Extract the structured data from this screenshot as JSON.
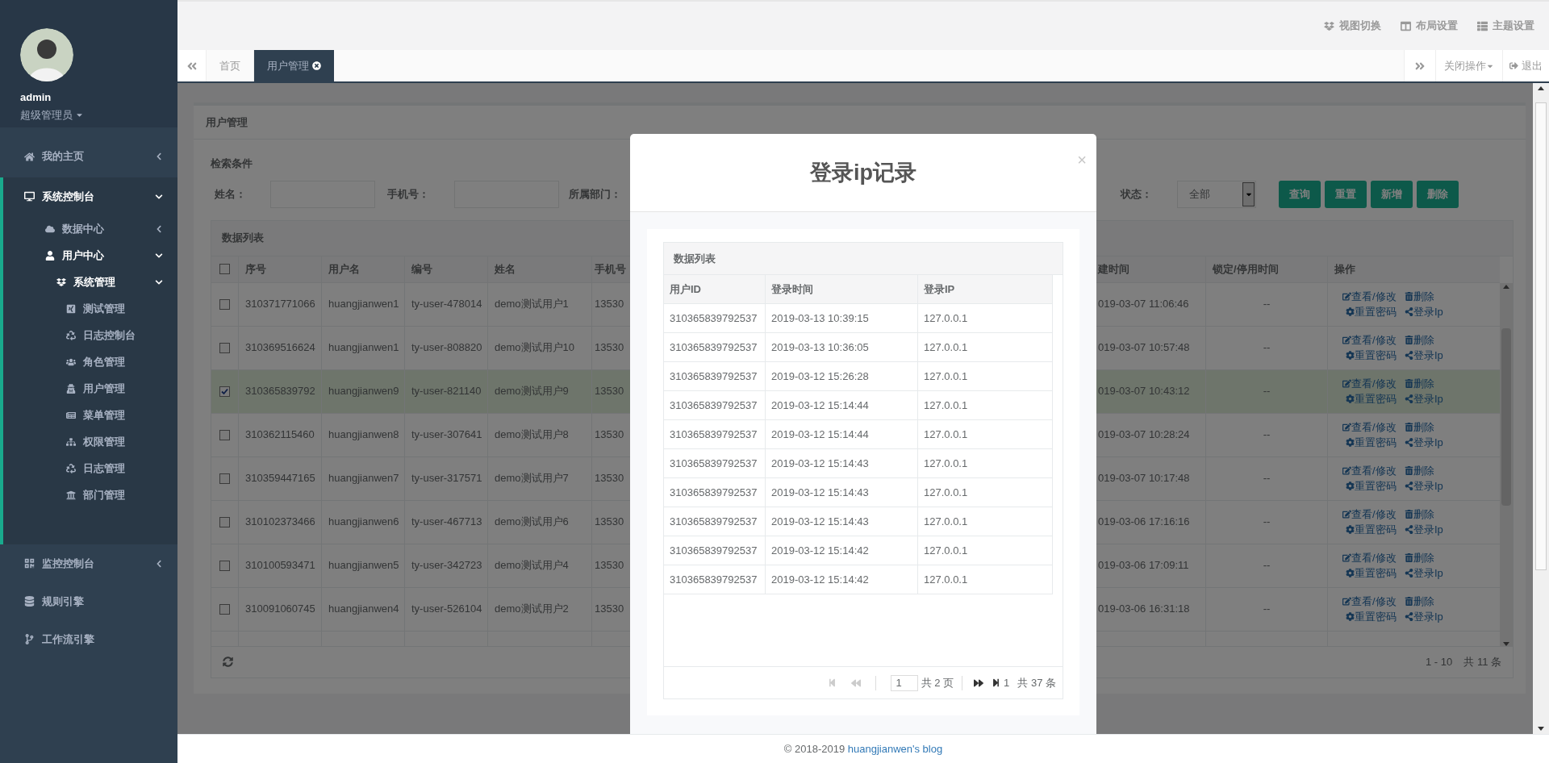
{
  "sidebar": {
    "profile": {
      "name": "admin",
      "role": "超级管理员"
    },
    "menu": [
      {
        "label": "我的主页",
        "kind": "group",
        "expanded": false,
        "selected": false
      },
      {
        "label": "系统控制台",
        "kind": "group",
        "expanded": true,
        "selected": true,
        "children": [
          {
            "label": "数据中心",
            "expanded": false,
            "selected": false
          },
          {
            "label": "用户中心",
            "expanded": true,
            "selected": true,
            "children": [
              {
                "label": "系统管理",
                "expanded": true,
                "selected": true,
                "children": [
                  {
                    "label": "测试管理",
                    "selected": false
                  },
                  {
                    "label": "日志控制台",
                    "selected": false
                  },
                  {
                    "label": "角色管理",
                    "selected": false
                  },
                  {
                    "label": "用户管理",
                    "selected": false
                  },
                  {
                    "label": "菜单管理",
                    "selected": false
                  },
                  {
                    "label": "权限管理",
                    "selected": false
                  },
                  {
                    "label": "日志管理",
                    "selected": false
                  },
                  {
                    "label": "部门管理",
                    "selected": false
                  }
                ]
              }
            ]
          }
        ]
      },
      {
        "label": "监控控制台",
        "kind": "group",
        "expanded": false,
        "selected": false
      },
      {
        "label": "规则引擎",
        "kind": "link",
        "selected": false
      },
      {
        "label": "工作流引擎",
        "kind": "link",
        "selected": false
      }
    ]
  },
  "topbar": {
    "actions": [
      "视图切换",
      "布局设置",
      "主题设置"
    ]
  },
  "tabbar": {
    "tabs": [
      {
        "label": "首页",
        "selected": false
      },
      {
        "label": "用户管理",
        "selected": true
      }
    ],
    "close_menu": "关闭操作",
    "logout": "退出"
  },
  "page": {
    "title": "用户管理",
    "search": {
      "heading": "检索条件",
      "fields": [
        {
          "label": "姓名："
        },
        {
          "label": "手机号："
        }
      ],
      "department_label": "所属部门：",
      "status": {
        "label": "状态：",
        "value": "全部"
      },
      "buttons": [
        "查询",
        "重置",
        "新增",
        "删除"
      ]
    },
    "list": {
      "title": "数据列表",
      "header_checked": false,
      "columns": [
        "序号",
        "用户名",
        "编号",
        "姓名",
        "手机号",
        "建时间",
        "锁定/停用时间",
        "操作"
      ],
      "rows": [
        {
          "selected": false,
          "cells": [
            "310371771066",
            "huangjianwen1",
            "ty-user-478014",
            "demo测试用户1",
            "13530",
            "019-03-07 11:06:46",
            "--"
          ],
          "actions": [
            "查看/修改",
            "删除",
            "重置密码",
            "登录Ip"
          ]
        },
        {
          "selected": false,
          "cells": [
            "310369516624",
            "huangjianwen1",
            "ty-user-808820",
            "demo测试用户10",
            "13530",
            "019-03-07 10:57:48",
            "--"
          ],
          "actions": [
            "查看/修改",
            "删除",
            "重置密码",
            "登录Ip"
          ]
        },
        {
          "selected": true,
          "cells": [
            "310365839792",
            "huangjianwen9",
            "ty-user-821140",
            "demo测试用户9",
            "13530",
            "019-03-07 10:43:12",
            "--"
          ],
          "actions": [
            "查看/修改",
            "删除",
            "重置密码",
            "登录Ip"
          ]
        },
        {
          "selected": false,
          "cells": [
            "310362115460",
            "huangjianwen8",
            "ty-user-307641",
            "demo测试用户8",
            "13530",
            "019-03-07 10:28:24",
            "--"
          ],
          "actions": [
            "查看/修改",
            "删除",
            "重置密码",
            "登录Ip"
          ]
        },
        {
          "selected": false,
          "cells": [
            "310359447165",
            "huangjianwen7",
            "ty-user-317571",
            "demo测试用户7",
            "13530",
            "019-03-07 10:17:48",
            "--"
          ],
          "actions": [
            "查看/修改",
            "删除",
            "重置密码",
            "登录Ip"
          ]
        },
        {
          "selected": false,
          "cells": [
            "310102373466",
            "huangjianwen6",
            "ty-user-467713",
            "demo测试用户6",
            "13530",
            "019-03-06 17:16:16",
            "--"
          ],
          "actions": [
            "查看/修改",
            "删除",
            "重置密码",
            "登录Ip"
          ]
        },
        {
          "selected": false,
          "cells": [
            "310100593471",
            "huangjianwen5",
            "ty-user-342723",
            "demo测试用户4",
            "13530",
            "019-03-06 17:09:11",
            "--"
          ],
          "actions": [
            "查看/修改",
            "删除",
            "重置密码",
            "登录Ip"
          ]
        },
        {
          "selected": false,
          "cells": [
            "310091060745",
            "huangjianwen4",
            "ty-user-526104",
            "demo测试用户2",
            "13530",
            "019-03-06 16:31:18",
            "--"
          ],
          "actions": [
            "查看/修改",
            "删除",
            "重置密码",
            "登录Ip"
          ]
        }
      ],
      "range": "1 - 10",
      "total": "共 11 条"
    }
  },
  "modal": {
    "title": "登录ip记录",
    "close": "×",
    "list_title": "数据列表",
    "columns": [
      "用户ID",
      "登录时间",
      "登录IP"
    ],
    "rows": [
      [
        "310365839792537",
        "2019-03-13 10:39:15",
        "127.0.0.1"
      ],
      [
        "310365839792537",
        "2019-03-13 10:36:05",
        "127.0.0.1"
      ],
      [
        "310365839792537",
        "2019-03-12 15:26:28",
        "127.0.0.1"
      ],
      [
        "310365839792537",
        "2019-03-12 15:14:44",
        "127.0.0.1"
      ],
      [
        "310365839792537",
        "2019-03-12 15:14:44",
        "127.0.0.1"
      ],
      [
        "310365839792537",
        "2019-03-12 15:14:43",
        "127.0.0.1"
      ],
      [
        "310365839792537",
        "2019-03-12 15:14:43",
        "127.0.0.1"
      ],
      [
        "310365839792537",
        "2019-03-12 15:14:43",
        "127.0.0.1"
      ],
      [
        "310365839792537",
        "2019-03-12 15:14:42",
        "127.0.0.1"
      ],
      [
        "310365839792537",
        "2019-03-12 15:14:42",
        "127.0.0.1"
      ]
    ],
    "pagination": {
      "page": "1",
      "pages": "共 2 页",
      "page_size": "1",
      "total": "共 37 条"
    }
  },
  "footer": {
    "text": "© 2018-2019",
    "link": "huangjianwen's blog"
  }
}
